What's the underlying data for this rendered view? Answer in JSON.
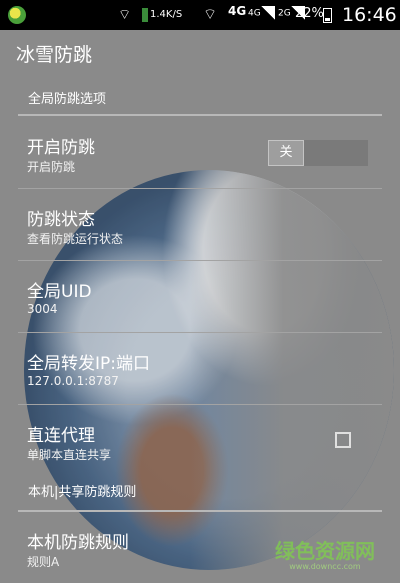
{
  "status_bar": {
    "network_speed": "1.4K/S",
    "network_type": "4G",
    "sim1_type": "4G",
    "sim2_type": "2G",
    "battery_percent": "22%",
    "time": "16:46"
  },
  "app": {
    "title": "冰雪防跳"
  },
  "sections": [
    {
      "header": "全局防跳选项",
      "items": [
        {
          "title": "开启防跳",
          "summary": "开启防跳",
          "widget": "toggle",
          "toggle_label": "关",
          "checked": false
        },
        {
          "title": "防跳状态",
          "summary": "查看防跳运行状态"
        },
        {
          "title": "全局UID",
          "summary": "3004"
        },
        {
          "title": "全局转发IP:端口",
          "summary": "127.0.0.1:8787"
        },
        {
          "title": "直连代理",
          "summary": "单脚本直连共享",
          "widget": "checkbox",
          "checked": false
        }
      ]
    },
    {
      "header": "本机|共享防跳规则",
      "items": [
        {
          "title": "本机防跳规则",
          "summary": "规则A"
        }
      ]
    }
  ],
  "watermark": {
    "text": "绿色资源网",
    "sub": "www.downcc.com"
  },
  "icons": {
    "app_notification": "app-icon",
    "wifi": "wifi-icon",
    "signal": "signal-icon",
    "battery": "battery-icon",
    "checkbox": "checkbox-icon"
  }
}
